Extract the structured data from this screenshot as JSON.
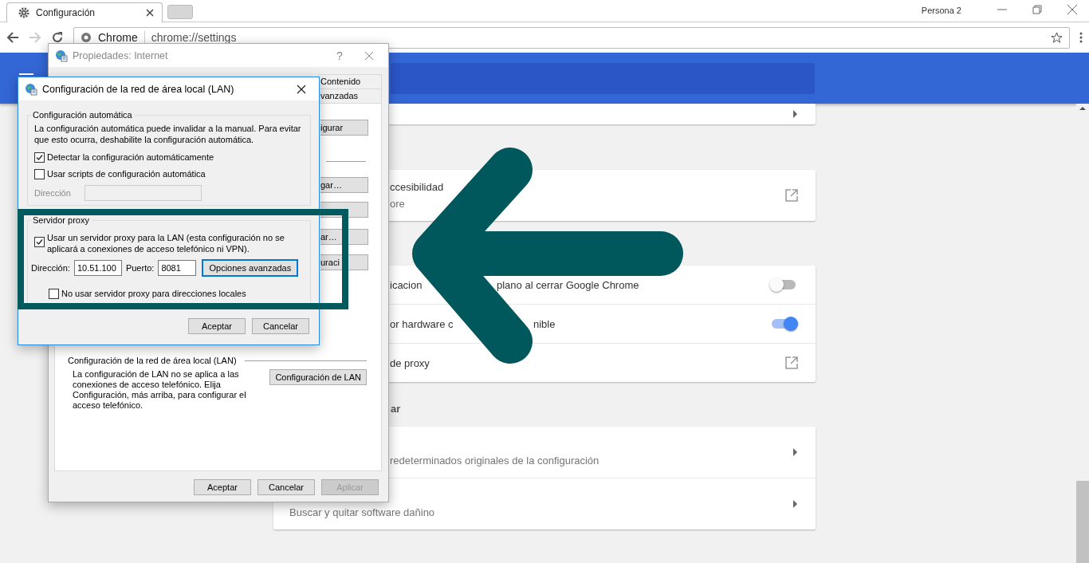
{
  "browser": {
    "tab": {
      "title": "Configuración"
    },
    "profile": "Persona 2",
    "omnibox": {
      "site": "Chrome",
      "url": "chrome://settings"
    }
  },
  "settings": {
    "blocks": [
      {
        "kind": "card",
        "rows": [
          {
            "kind": "arrow"
          }
        ]
      },
      {
        "kind": "card",
        "rows": [
          {
            "kind": "link",
            "clipped": true,
            "title": "ccesibilidad",
            "subtitle": "ore"
          }
        ]
      },
      {
        "kind": "card",
        "rows": [
          {
            "kind": "toggle",
            "clipped": true,
            "title_parts": [
              "icacion",
              "plano al cerrar Google Chrome"
            ],
            "on": false
          },
          {
            "kind": "toggle",
            "clipped": true,
            "title_parts": [
              "or hardware c",
              "nible"
            ],
            "on": true
          },
          {
            "kind": "link",
            "clipped": true,
            "title": "de proxy"
          }
        ]
      },
      {
        "kind": "heading",
        "text": "ar"
      },
      {
        "kind": "card",
        "rows": [
          {
            "kind": "arrow",
            "clipped": true,
            "subtitle": "redeterminados originales de la configuración"
          },
          {
            "kind": "arrow",
            "clipped": false,
            "subtitle": "Buscar y quitar software dañino"
          }
        ]
      }
    ]
  },
  "properties_dialog": {
    "title": "Propiedades: Internet",
    "help": "?",
    "tabs": [
      "Contenido",
      "vanzadas"
    ],
    "side_buttons": [
      "igurar",
      "gar…",
      "ar…",
      "uraci"
    ],
    "lan_section": {
      "heading": "Configuración de la red de área local (LAN)",
      "description": "La configuración de LAN no se aplica a las conexiones de acceso telefónico. Elija Configuración, más arriba, para configurar el acceso telefónico.",
      "button": "Configuración de LAN"
    },
    "buttons": [
      {
        "label": "Aceptar",
        "disabled": false
      },
      {
        "label": "Cancelar",
        "disabled": false
      },
      {
        "label": "Aplicar",
        "disabled": true
      }
    ]
  },
  "lan_dialog": {
    "title": "Configuración de la red de área local (LAN)",
    "auto_group": {
      "legend": "Configuración automática",
      "description": "La configuración automática puede invalidar a la manual. Para evitar que esto ocurra, deshabilite la configuración automática.",
      "options": [
        {
          "label": "Detectar la configuración automáticamente",
          "checked": true
        },
        {
          "label": "Usar scripts de configuración automática",
          "checked": false
        }
      ],
      "address": {
        "label": "Dirección",
        "disabled": true
      }
    },
    "proxy_group": {
      "legend": "Servidor proxy",
      "use_proxy": {
        "label": "Usar un servidor proxy para la LAN (esta configuración no se aplicará a conexiones de acceso telefónico ni VPN).",
        "checked": true
      },
      "address_label": "Dirección:",
      "address_value": "10.51.100",
      "port_label": "Puerto:",
      "port_value": "8081",
      "advanced_button": "Opciones avanzadas",
      "bypass": {
        "label": "No usar servidor proxy para direcciones locales",
        "checked": false
      }
    },
    "buttons": [
      "Aceptar",
      "Cancelar"
    ]
  }
}
